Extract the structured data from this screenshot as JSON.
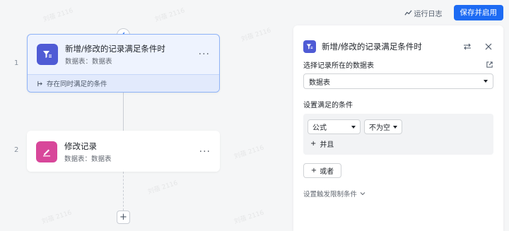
{
  "watermark": "刘蓓 2116",
  "header": {
    "run_log_label": "运行日志",
    "save_enable_label": "保存并启用"
  },
  "flow": {
    "nodes": [
      {
        "index": "1",
        "title": "新增/修改的记录满足条件时",
        "subtitle": "数据表：数据表",
        "footer": "存在同时满足的条件",
        "icon": "filter-icon",
        "color": "#4f5bd5"
      },
      {
        "index": "2",
        "title": "修改记录",
        "subtitle": "数据表：数据表",
        "icon": "edit-icon",
        "color": "#d8479a"
      }
    ],
    "more_label": "···",
    "add_label": "+"
  },
  "panel": {
    "title": "新增/修改的记录满足条件时",
    "table_section_label": "选择记录所在的数据表",
    "table_value": "数据表",
    "condition_section_label": "设置满足的条件",
    "condition": {
      "field": "公式",
      "operator": "不为空"
    },
    "and_label": "并且",
    "or_label": "或者",
    "limit_label": "设置触发限制条件"
  },
  "colors": {
    "accent": "#1d6bf3",
    "trigger_icon": "#4f5bd5",
    "action_icon": "#d8479a"
  }
}
